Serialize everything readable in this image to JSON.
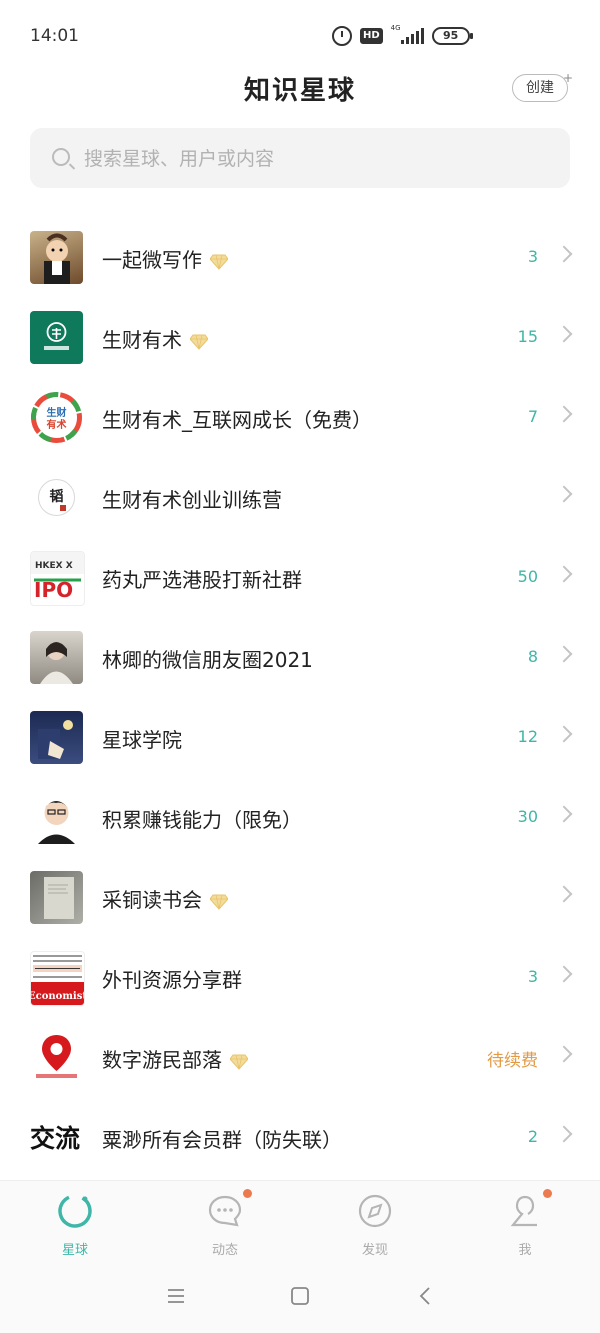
{
  "status_bar": {
    "time": "14:01",
    "network": "4G",
    "hd": "HD",
    "battery": "95"
  },
  "header": {
    "title": "知识星球",
    "create_label": "创建"
  },
  "search": {
    "placeholder": "搜索星球、用户或内容"
  },
  "colors": {
    "accent": "#3fb6a8",
    "warning": "#e29a45",
    "badge": "#ec7a4e",
    "diamond": "#e8c46a"
  },
  "groups": [
    {
      "name": "一起微写作",
      "premium": true,
      "count": "3",
      "icon": "cartoon-avatar"
    },
    {
      "name": "生财有术",
      "premium": true,
      "count": "15",
      "icon": "green-coin-logo"
    },
    {
      "name": "生财有术_互联网成长（免费）",
      "premium": false,
      "count": "7",
      "icon": "colorful-circle-logo"
    },
    {
      "name": "生财有术创业训练营",
      "premium": false,
      "count": "",
      "icon": "calligraphy-logo"
    },
    {
      "name": "药丸严选港股打新社群",
      "premium": false,
      "count": "50",
      "icon": "hkex-ipo-logo"
    },
    {
      "name": "林卿的微信朋友圈2021",
      "premium": false,
      "count": "8",
      "icon": "person-photo"
    },
    {
      "name": "星球学院",
      "premium": false,
      "count": "12",
      "icon": "night-illustration"
    },
    {
      "name": "积累赚钱能力（限免）",
      "premium": false,
      "count": "30",
      "icon": "man-avatar"
    },
    {
      "name": "采铜读书会",
      "premium": true,
      "count": "",
      "icon": "book-photo"
    },
    {
      "name": "外刊资源分享群",
      "premium": false,
      "count": "3",
      "icon": "newspaper-logo"
    },
    {
      "name": "数字游民部落",
      "premium": true,
      "count": "待续费",
      "icon": "location-pin-logo"
    },
    {
      "name": "粟渺所有会员群（防失联）",
      "premium": false,
      "count": "2",
      "icon": "jiaoliu-logo"
    }
  ],
  "tabs": [
    {
      "label": "星球",
      "icon": "planet-icon",
      "active": true,
      "badge": false
    },
    {
      "label": "动态",
      "icon": "chat-bubble-icon",
      "active": false,
      "badge": true
    },
    {
      "label": "发现",
      "icon": "compass-icon",
      "active": false,
      "badge": false
    },
    {
      "label": "我",
      "icon": "person-icon",
      "active": false,
      "badge": true
    }
  ],
  "avatar_text": {
    "green_coin": "生财有术",
    "colorful_circle": "生财有术",
    "calligraphy": "韬",
    "hkex": "HKEX",
    "ipo": "IPO",
    "newspaper": "The Economist",
    "jiaoliu": "交流",
    "location_caption": "数字游民部落"
  }
}
